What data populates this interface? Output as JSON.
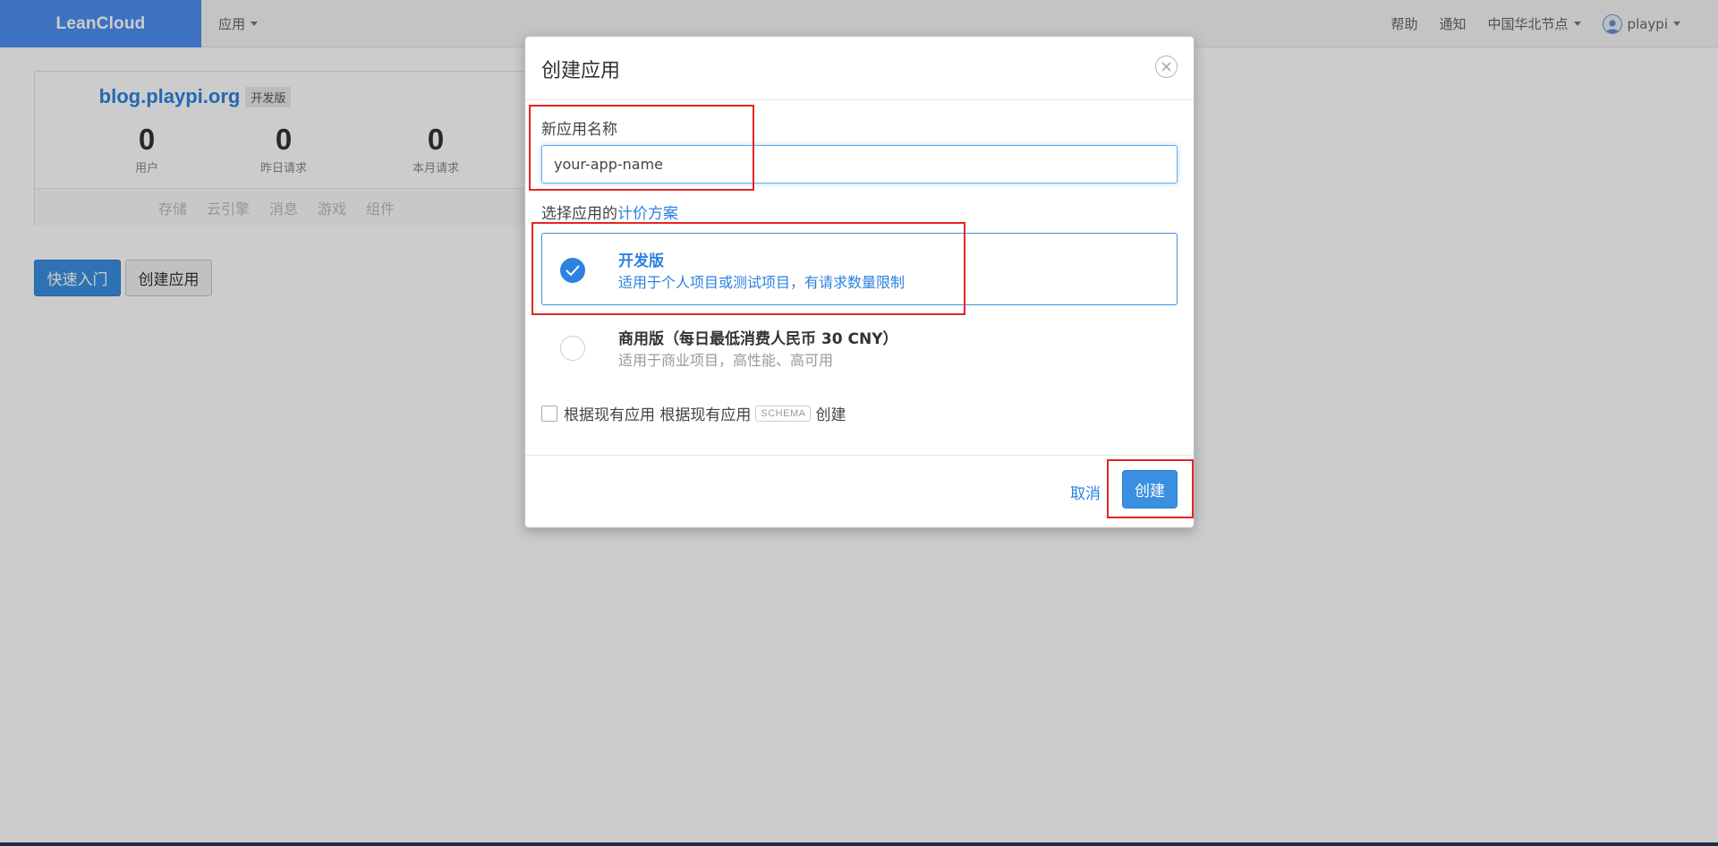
{
  "navbar": {
    "brand": "LeanCloud",
    "apps_menu": "应用",
    "right": {
      "help": "帮助",
      "notifications": "通知",
      "region": "中国华北节点",
      "username": "playpi"
    }
  },
  "app_card": {
    "name": "blog.playpi.org",
    "tier": "开发版",
    "stats": [
      {
        "value": "0",
        "label": "用户"
      },
      {
        "value": "0",
        "label": "昨日请求"
      },
      {
        "value": "0",
        "label": "本月请求"
      }
    ],
    "tabs": [
      "存储",
      "云引擎",
      "消息",
      "游戏",
      "组件"
    ]
  },
  "page_buttons": {
    "quick_start": "快速入门",
    "create_app": "创建应用"
  },
  "modal": {
    "title": "创建应用",
    "name_label": "新应用名称",
    "name_value": "your-app-name",
    "plan_label_prefix": "选择应用的",
    "plan_label_link": "计价方案",
    "plans": [
      {
        "name": "开发版",
        "desc": "适用于个人项目或测试项目，有请求数量限制",
        "selected": true
      },
      {
        "name": "商用版（每日最低消费人民币 30 CNY）",
        "desc": "适用于商业项目，高性能、高可用",
        "selected": false
      }
    ],
    "schema_text_1": "根据现有应用 根据现有应用",
    "schema_badge": "SCHEMA",
    "schema_text_2": "创建",
    "cancel": "取消",
    "create": "创建"
  },
  "colors": {
    "brand": "#4b8ff0",
    "primary": "#3b8fe0",
    "link": "#2b82e0",
    "annotation": "#e42424",
    "overlay": "rgba(0,0,0,0.2)"
  }
}
